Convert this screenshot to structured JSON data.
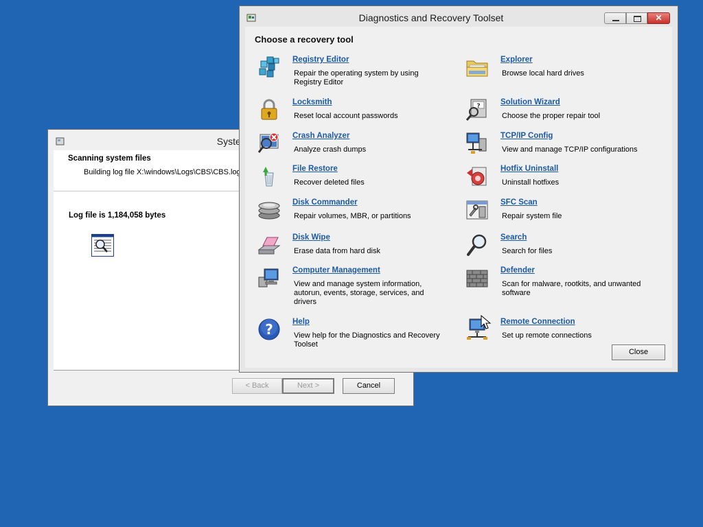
{
  "sfr": {
    "title": "System File Repa",
    "scan_title": "Scanning system files",
    "scan_sub": "Building log file X:\\windows\\Logs\\CBS\\CBS.log",
    "log_size": "Log file is 1,184,058 bytes",
    "buttons": {
      "back": "< Back",
      "next": "Next >",
      "cancel": "Cancel"
    }
  },
  "dart": {
    "title": "Diagnostics and Recovery Toolset",
    "heading": "Choose a recovery tool",
    "close_label": "Close",
    "left_tools": [
      {
        "name": "Registry Editor",
        "desc": "Repair the operating system by using Registry Editor",
        "icon": "registry-icon"
      },
      {
        "name": "Locksmith",
        "desc": "Reset local account passwords",
        "icon": "padlock-icon"
      },
      {
        "name": "Crash Analyzer",
        "desc": "Analyze crash dumps",
        "icon": "crash-analyzer-icon"
      },
      {
        "name": "File Restore",
        "desc": "Recover deleted files",
        "icon": "recycle-bin-icon"
      },
      {
        "name": "Disk Commander",
        "desc": "Repair volumes, MBR, or partitions",
        "icon": "disk-stack-icon"
      },
      {
        "name": "Disk Wipe",
        "desc": "Erase data from hard disk",
        "icon": "eraser-icon"
      },
      {
        "name": "Computer Management",
        "desc": "View and manage system information, autorun, events, storage, services, and drivers",
        "icon": "computer-management-icon"
      },
      {
        "name": "Help",
        "desc": "View help for the Diagnostics and Recovery Toolset",
        "icon": "help-icon"
      }
    ],
    "right_tools": [
      {
        "name": "Explorer",
        "desc": "Browse local hard drives",
        "icon": "folder-icon"
      },
      {
        "name": "Solution Wizard",
        "desc": "Choose the proper repair tool",
        "icon": "wizard-icon"
      },
      {
        "name": "TCP/IP Config",
        "desc": "View and manage TCP/IP configurations",
        "icon": "network-icon"
      },
      {
        "name": "Hotfix Uninstall",
        "desc": "Uninstall hotfixes",
        "icon": "hotfix-icon"
      },
      {
        "name": "SFC Scan",
        "desc": "Repair system file",
        "icon": "sfc-icon"
      },
      {
        "name": "Search",
        "desc": "Search for files",
        "icon": "magnifier-icon"
      },
      {
        "name": "Defender",
        "desc": "Scan for malware, rootkits, and unwanted software",
        "icon": "wall-icon"
      },
      {
        "name": "Remote Connection",
        "desc": "Set up remote connections",
        "icon": "remote-connection-icon"
      }
    ]
  }
}
